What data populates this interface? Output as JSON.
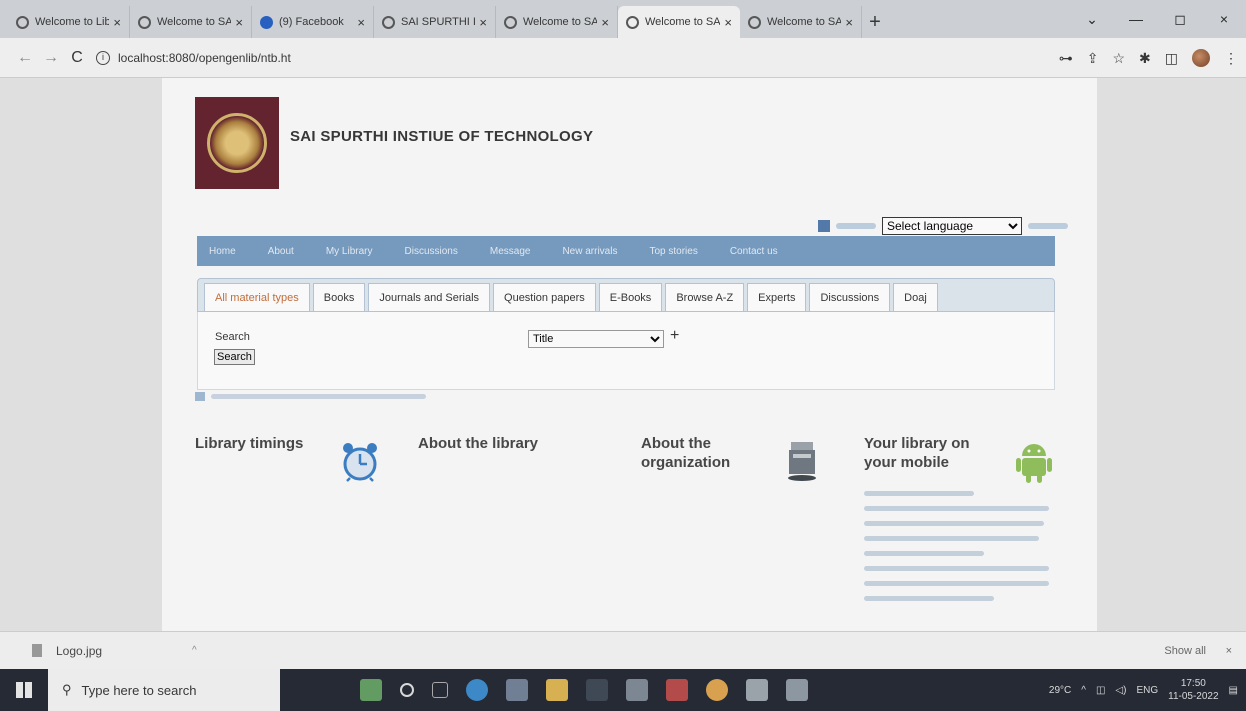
{
  "browser": {
    "tabs": [
      {
        "label": "Welcome to Lib",
        "icon": "globe-icon"
      },
      {
        "label": "Welcome to SAI",
        "icon": "globe-icon"
      },
      {
        "label": "(9) Facebook",
        "icon": "facebook-icon"
      },
      {
        "label": "SAI SPURTHI I",
        "icon": "globe-icon"
      },
      {
        "label": "Welcome to SAI",
        "icon": "globe-icon"
      },
      {
        "label": "Welcome to SAI",
        "icon": "globe-icon",
        "active": true
      },
      {
        "label": "Welcome to SAI",
        "icon": "globe-icon"
      }
    ],
    "close_glyph": "×",
    "new_tab_glyph": "+",
    "window_controls": {
      "dropdown": "⌄",
      "minimize": "—",
      "maximize": "◻",
      "close": "×"
    },
    "nav": {
      "back": "←",
      "forward": "→",
      "reload": "C"
    },
    "url": "localhost:8080/opengenlib/ntb.ht",
    "toolbar_glyphs": {
      "key": "⊶",
      "share": "⇪",
      "star": "☆",
      "extensions": "✱",
      "sidebar": "◫",
      "menu": "⋮"
    }
  },
  "page": {
    "site_title": "SAI SPURTHI INSTIUE OF TECHNOLOGY",
    "language_select": {
      "selected": "Select language"
    },
    "main_nav": [
      "Home",
      "About",
      "My Library",
      "Discussions",
      "Message",
      "New arrivals",
      "Top stories",
      "Contact us"
    ],
    "material_tabs": [
      {
        "label": "All material types",
        "active": true
      },
      {
        "label": "Books"
      },
      {
        "label": "Journals and Serials"
      },
      {
        "label": "Question papers"
      },
      {
        "label": "E-Books"
      },
      {
        "label": "Browse A-Z"
      },
      {
        "label": "Experts"
      },
      {
        "label": "Discussions"
      },
      {
        "label": "Doaj"
      }
    ],
    "search": {
      "label": "Search",
      "button_label": "Search",
      "field_select": "Title",
      "add_label": "+"
    },
    "features": [
      {
        "title": "Library timings",
        "icon": "alarm-clock-icon"
      },
      {
        "title": "About the library"
      },
      {
        "title": "About the\norganization",
        "icon": "book-stack-icon"
      },
      {
        "title": "Your library on\nyour mobile",
        "icon": "android-icon"
      }
    ]
  },
  "download_bar": {
    "file_name": "Logo.jpg",
    "chevron": "^",
    "show_all": "Show all",
    "close": "×"
  },
  "taskbar": {
    "search_placeholder": "Type here to search",
    "weather": "29°C",
    "language": "ENG",
    "time": "17:50",
    "date": "11-05-2022"
  }
}
